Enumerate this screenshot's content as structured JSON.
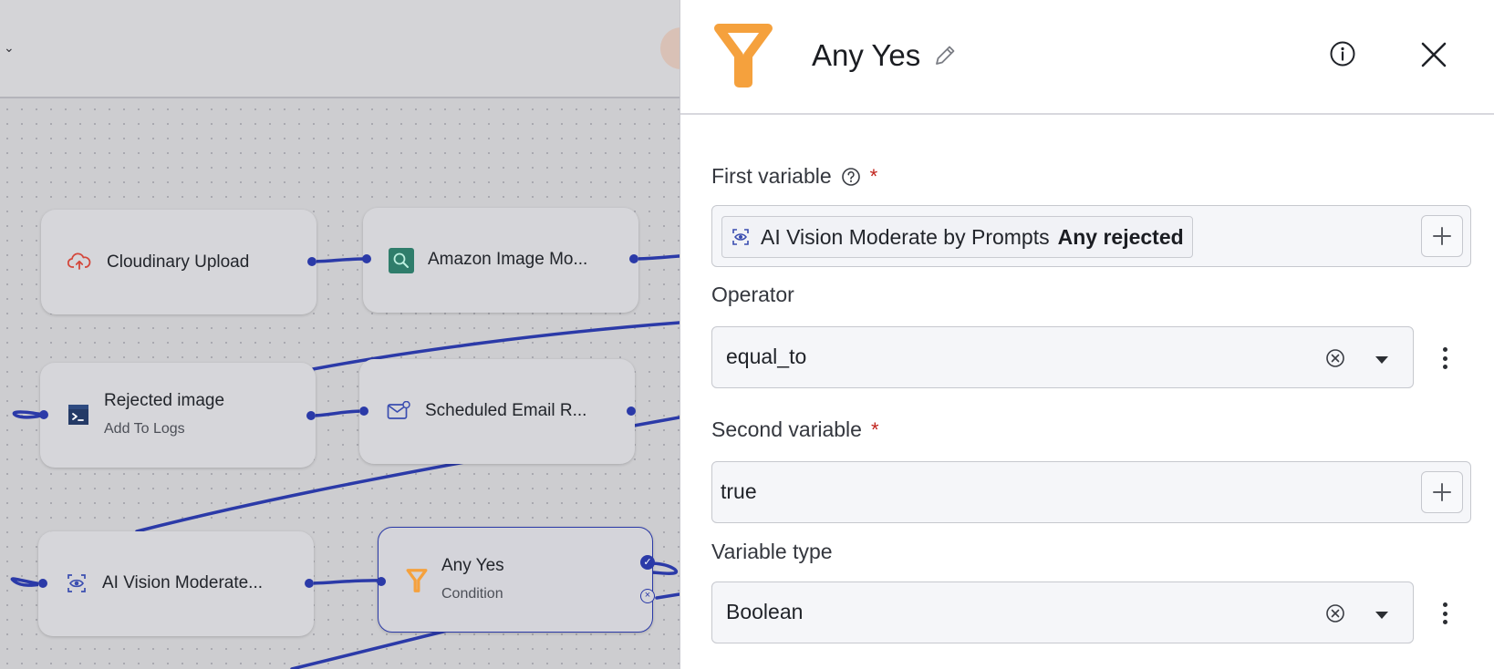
{
  "canvas": {
    "nodes": [
      {
        "id": "cloudinary",
        "title": "Cloudinary Upload",
        "icon": "cloud-upload-icon"
      },
      {
        "id": "amazon",
        "title": "Amazon Image Mo...",
        "icon": "amazon-image-moderation-icon"
      },
      {
        "id": "rejected",
        "title": "Rejected image",
        "subtitle": "Add To Logs",
        "icon": "terminal-icon"
      },
      {
        "id": "email",
        "title": "Scheduled Email R...",
        "icon": "mail-icon"
      },
      {
        "id": "vision",
        "title": "AI Vision Moderate...",
        "icon": "ai-vision-icon"
      },
      {
        "id": "anyyes",
        "title": "Any Yes",
        "subtitle": "Condition",
        "icon": "filter-icon",
        "selected": true
      }
    ],
    "edge_color": "#2b3aa8"
  },
  "panel": {
    "title": "Any Yes",
    "accent_color": "#f5a13d",
    "first_variable": {
      "label": "First variable",
      "required_mark": "*",
      "chip_source": "AI Vision Moderate by Prompts",
      "chip_field": "Any rejected"
    },
    "operator": {
      "label": "Operator",
      "value": "equal_to"
    },
    "second_variable": {
      "label": "Second variable",
      "required_mark": "*",
      "value": "true"
    },
    "variable_type": {
      "label": "Variable type",
      "value": "Boolean"
    }
  }
}
